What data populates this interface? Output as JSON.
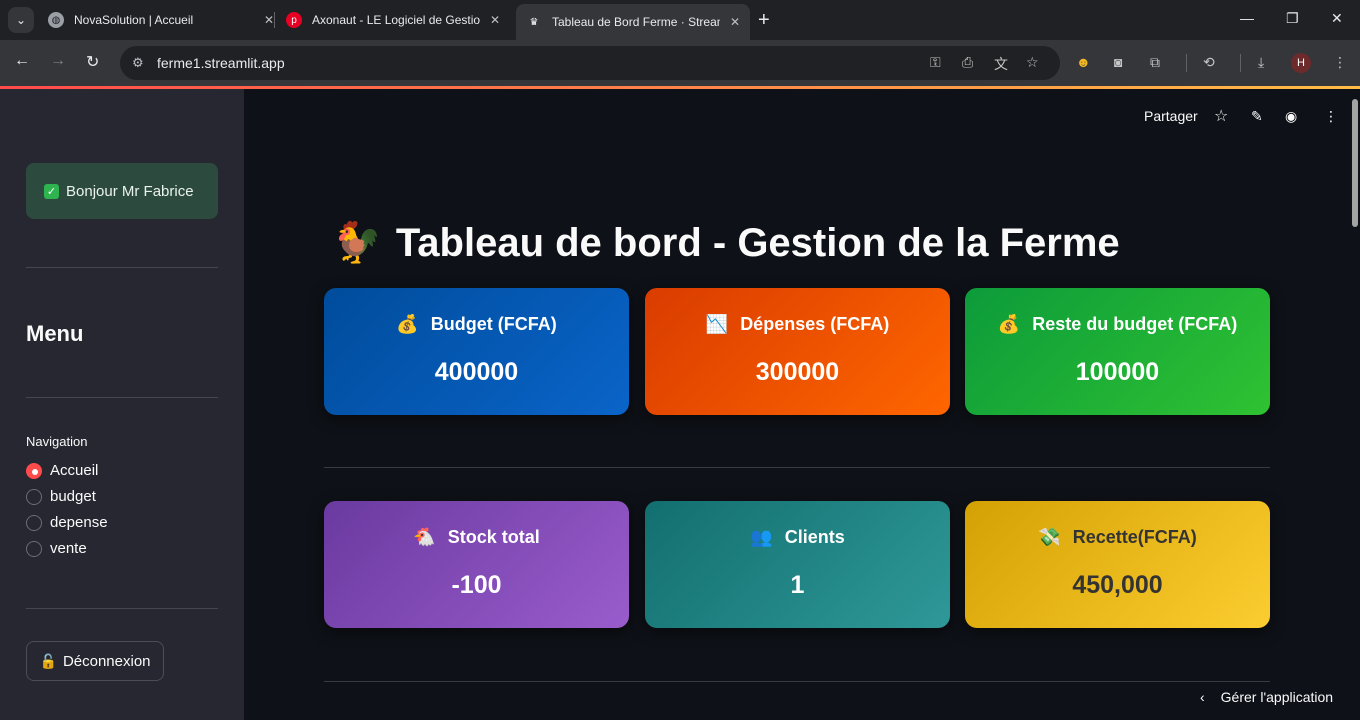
{
  "browser": {
    "tabs": [
      {
        "title": "NovaSolution | Accueil"
      },
      {
        "title": "Axonaut - LE Logiciel de Gestion"
      },
      {
        "title": "Tableau de Bord Ferme · Streamlit"
      }
    ],
    "new_tab": "+",
    "url": "ferme1.streamlit.app",
    "profile_initial": "H"
  },
  "app": {
    "header": {
      "share_label": "Partager"
    },
    "sidebar": {
      "greeting": "Bonjour Mr Fabrice",
      "menu_title": "Menu",
      "navigation_label": "Navigation",
      "nav_options": [
        "Accueil",
        "budget",
        "depense",
        "vente"
      ],
      "selected": "Accueil",
      "logout_label": "Déconnexion"
    },
    "title": "Tableau de bord - Gestion de la Ferme",
    "title_emoji": "🐓",
    "cards_row1": [
      {
        "emoji": "💰",
        "label": "Budget (FCFA)",
        "value": "400000",
        "color": "#0a5ab8"
      },
      {
        "emoji": "📉",
        "label": "Dépenses (FCFA)",
        "value": "300000",
        "color": "#f05000"
      },
      {
        "emoji": "💰",
        "label": "Reste du budget (FCFA)",
        "value": "100000",
        "color": "#1faf36"
      }
    ],
    "cards_row2": [
      {
        "emoji": "🐔",
        "label": "Stock total",
        "value": "-100",
        "color": "#8250b8"
      },
      {
        "emoji": "👥",
        "label": "Clients",
        "value": "1",
        "color": "#208585"
      },
      {
        "emoji": "💸",
        "label": "Recette(FCFA)",
        "value": "450,000",
        "color": "#ebb81c"
      }
    ],
    "manage_app": "Gérer l'application"
  }
}
